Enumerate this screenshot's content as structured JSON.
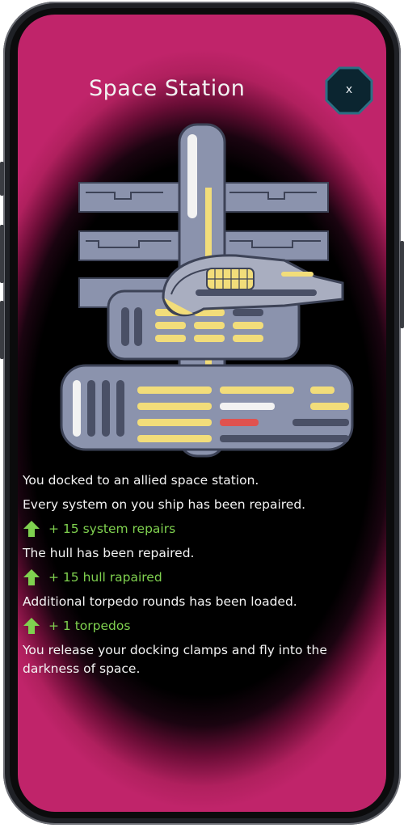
{
  "dialog": {
    "title": "Space Station",
    "close_label": "x"
  },
  "story": {
    "intro": "You docked to an allied space station.",
    "repair_text": "Every system on you ship has been repaired.",
    "system_reward": "+ 15 system repairs",
    "hull_text": "The hull has been repaired.",
    "hull_reward": "+ 15 hull rapaired",
    "torpedo_text": "Additional torpedo rounds has been loaded.",
    "torpedo_reward": "+ 1 torpedos",
    "outro": "You release your docking clamps and fly into the darkness of space."
  },
  "icons": {
    "reward_arrow": "arrow-up-icon",
    "close": "close-icon"
  },
  "colors": {
    "background_edge": "#c0246a",
    "reward_green": "#7fd14f",
    "station_gray": "#8b93ad",
    "lights_yellow": "#f2dd7a",
    "warning_red": "#e0524f"
  }
}
